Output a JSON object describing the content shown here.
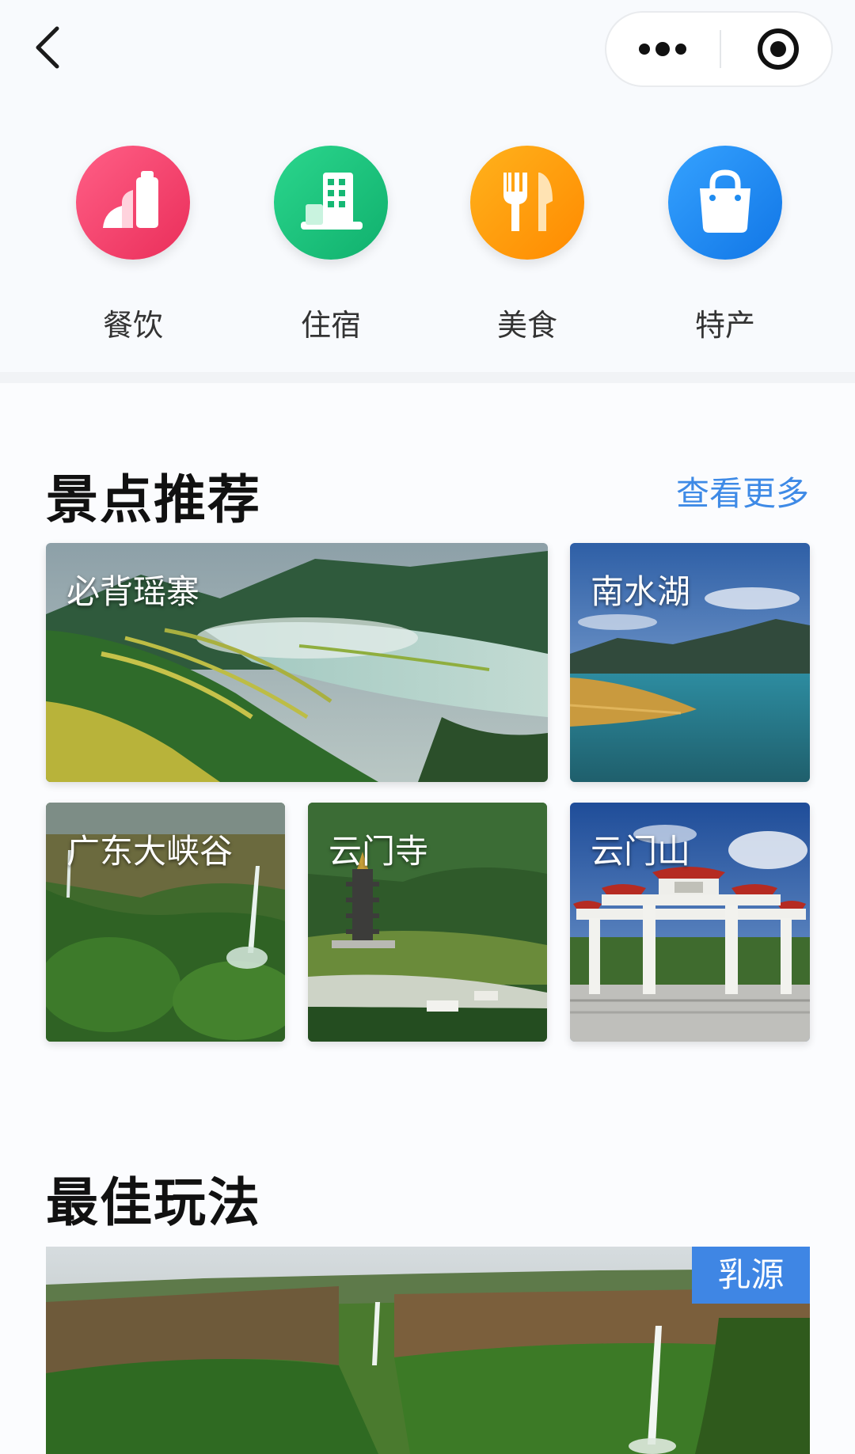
{
  "nav": {
    "back_icon": "chevron-left-icon",
    "more_icon": "more-dots-icon",
    "close_icon": "target-circle-icon"
  },
  "categories": [
    {
      "label": "餐饮",
      "icon": "drink-cup-icon",
      "color": "#f0456a"
    },
    {
      "label": "住宿",
      "icon": "hotel-building-icon",
      "color": "#18c27d"
    },
    {
      "label": "美食",
      "icon": "fork-knife-icon",
      "color": "#ff9a0c"
    },
    {
      "label": "特产",
      "icon": "shopping-bag-icon",
      "color": "#1f8cf0"
    }
  ],
  "scenic": {
    "title": "景点推荐",
    "more_link": "查看更多",
    "spots": [
      {
        "name": "必背瑶寨"
      },
      {
        "name": "南水湖"
      },
      {
        "name": "广东大峡谷"
      },
      {
        "name": "云门寺"
      },
      {
        "name": "云门山"
      }
    ]
  },
  "best_play": {
    "title": "最佳玩法",
    "tag": "乳源"
  },
  "colors": {
    "accent_link": "#3e8ae6",
    "tag_background": "#3f86e4",
    "title_text": "#111111"
  }
}
